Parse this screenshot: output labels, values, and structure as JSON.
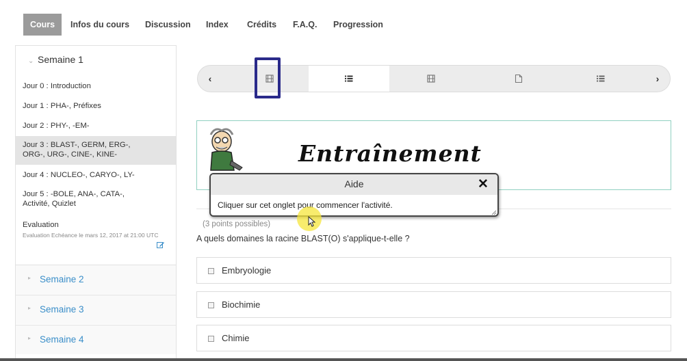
{
  "nav": {
    "tabs": [
      "Cours",
      "Infos du cours",
      "Discussion",
      "Index",
      "Crédits",
      "F.A.Q.",
      "Progression"
    ],
    "active_tab": "Cours"
  },
  "sidebar": {
    "open_week": "Semaine 1",
    "lessons": [
      "Jour 0 : Introduction",
      "Jour 1 : PHA-, Préfixes",
      "Jour 2 : PHY-, -EM-",
      "Jour 3 : BLAST-, GERM, ERG-, ORG-, URG-, CINE-, KINE-",
      "Jour 4 : NUCLEO-, CARYO-, LY-",
      "Jour 5 : -BOLE, ANA-, CATA-, Activité, Quizlet"
    ],
    "active_lesson": "Jour 3 : BLAST-, GERM, ERG-, ORG-, URG-, CINE-, KINE-",
    "evaluation": {
      "title": "Evaluation",
      "due": "Evaluation Echéance le mars 12, 2017 at 21:00 UTC"
    },
    "closed_weeks": [
      "Semaine 2",
      "Semaine 3",
      "Semaine 4"
    ]
  },
  "sequence": {
    "prev_label": "‹",
    "next_label": "›",
    "items": [
      "video-icon",
      "list-icon",
      "video-icon",
      "document-icon",
      "list-icon"
    ],
    "active_index": 1
  },
  "unit": {
    "title": "Entraînement"
  },
  "tooltip": {
    "title": "Aide",
    "close_label": "✕",
    "body": "Cliquer sur cet onglet pour commencer l'activité."
  },
  "problem": {
    "points": "(3 points possibles)",
    "question": "A quels domaines la racine BLAST(O) s'applique-t-elle ?",
    "options": [
      "Embryologie",
      "Biochimie",
      "Chimie"
    ]
  },
  "colors": {
    "accent_blue": "#3a8ec9",
    "highlight_border": "#2a2a8a",
    "title_border": "#8fd0c0",
    "active_tab_bg": "#9b9b9b"
  }
}
